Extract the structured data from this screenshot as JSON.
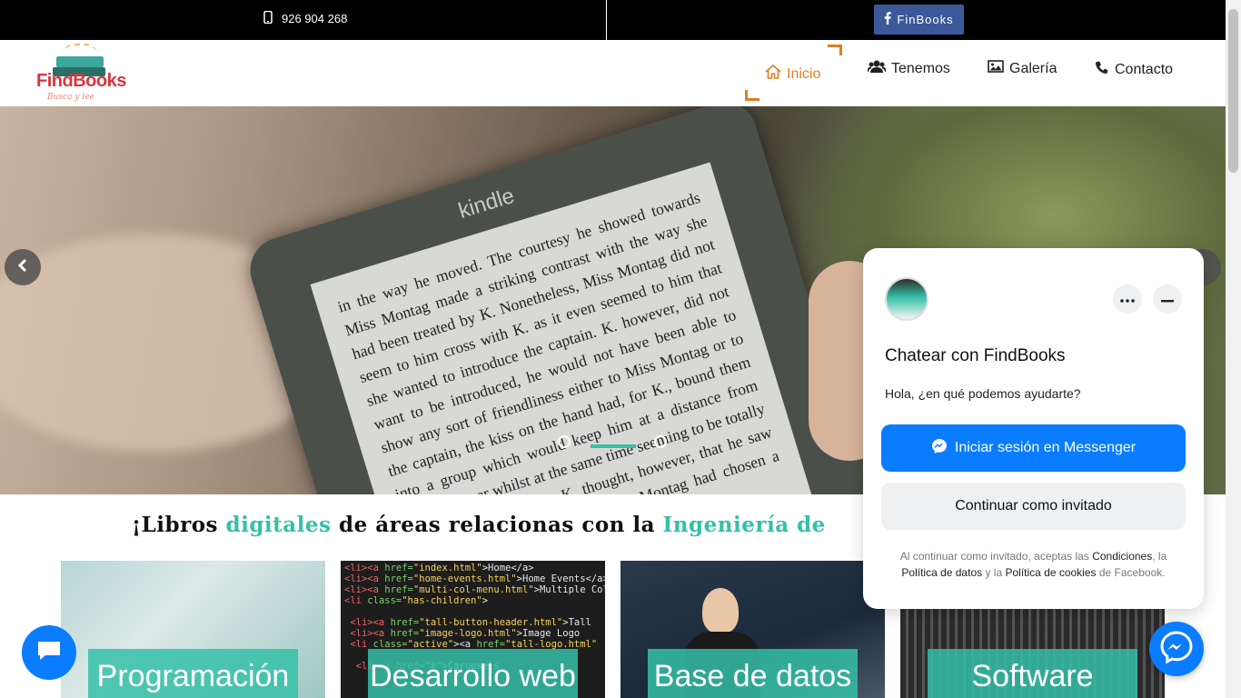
{
  "topbar": {
    "phone_icon": "mobile-phone-icon",
    "phone": "926 904 268",
    "facebook_label": "FinBooks",
    "facebook_icon": "facebook-icon"
  },
  "logo": {
    "name": "FindBooks",
    "tagline": "Busca y lee"
  },
  "nav": {
    "items": [
      {
        "label": "Inicio",
        "icon": "home-icon",
        "active": true
      },
      {
        "label": "Tenemos",
        "icon": "users-icon"
      },
      {
        "label": "Galería",
        "icon": "image-icon"
      },
      {
        "label": "Contacto",
        "icon": "phone-icon"
      }
    ]
  },
  "hero": {
    "kindle_brand": "kindle",
    "kindle_text": "in the way he moved. The courtesy he showed towards Miss Montag made a striking contrast with the way she had been treated by K. Nonetheless, Miss Montag did not seem to him cross with K. as it even seemed to him that she wanted to introduce the captain. K. however, did not want to be introduced, he would not have been able to show any sort of friendliness either to Miss Montag or to the captain, the kiss on the hand had, for K., bound them into a group which would keep him at a distance from Miss Bürstner whilst at the same time seeming to be totally harmless and unselfish. K. thought, however, that he saw more than that, he saw that Miss Montag had chosen a means of doing it that was, between K. and"
  },
  "tagline": {
    "part1": "¡Libros ",
    "hl1": "digitales",
    "part2": " de áreas relacionas con la ",
    "hl2": "Ingeniería de"
  },
  "cards": [
    {
      "label": "Programación"
    },
    {
      "label": "Desarrollo web"
    },
    {
      "label": "Base de datos"
    },
    {
      "label": "Software"
    }
  ],
  "chat": {
    "title": "Chatear con FindBooks",
    "greeting": "Hola, ¿en qué podemos ayudarte?",
    "primary_button": "Iniciar sesión en Messenger",
    "secondary_button": "Continuar como invitado",
    "legal_1": "Al continuar como invitado, aceptas las ",
    "legal_terms": "Condiciones",
    "legal_2": ", la ",
    "legal_data": "Política de datos",
    "legal_3": " y la ",
    "legal_cookies": "Política de cookies",
    "legal_4": " de Facebook."
  },
  "colors": {
    "accent": "#35bfa8",
    "nav_active": "#e27d22",
    "messenger": "#0a7cff",
    "facebook": "#3b5998"
  }
}
